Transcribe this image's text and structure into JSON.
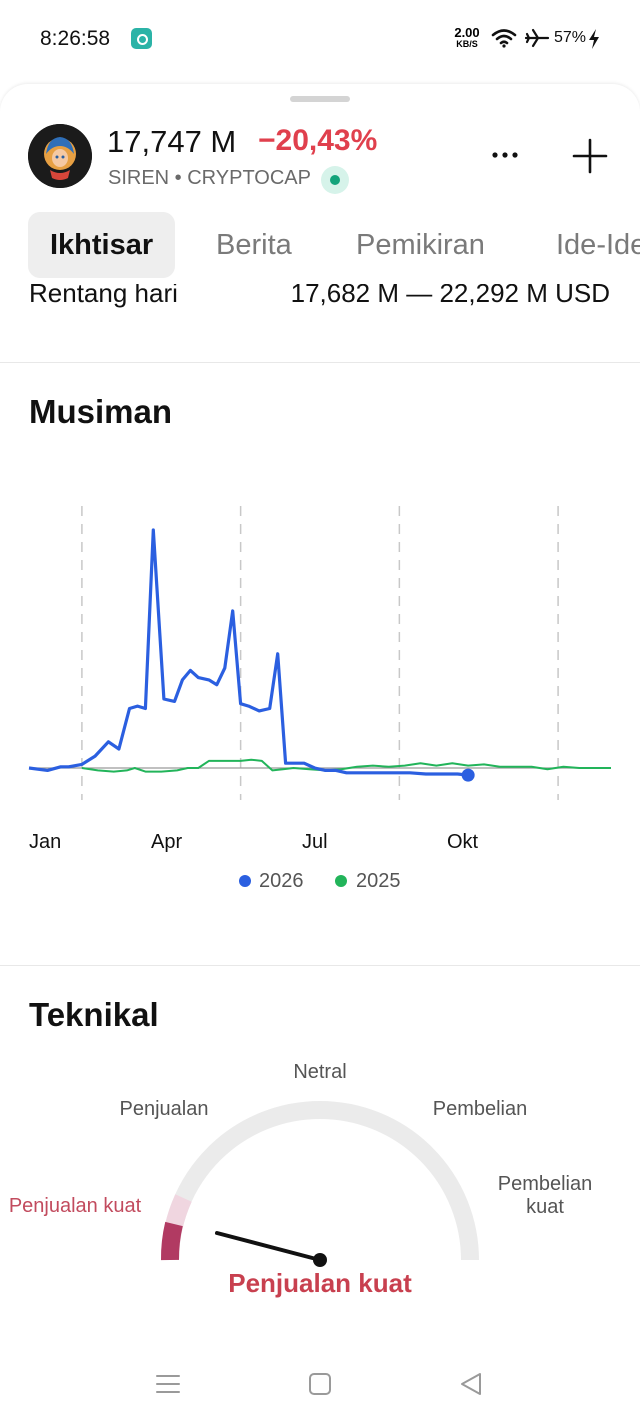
{
  "status_bar": {
    "time": "8:26:58",
    "net_speed_value": "2.00",
    "net_speed_unit": "KB/S",
    "battery": "57%",
    "icons": [
      "app-notification-icon",
      "wifi-icon",
      "airplane-mode-icon",
      "charging-bolt-icon"
    ]
  },
  "header": {
    "price": "17,747 M",
    "change": "−20,43%",
    "symbol": "SIREN • CRYPTOCAP",
    "colors": {
      "negative": "#e0404d",
      "live": "#13a37b"
    }
  },
  "tabs": [
    {
      "label": "Ikhtisar",
      "active": true
    },
    {
      "label": "Berita",
      "active": false
    },
    {
      "label": "Pemikiran",
      "active": false
    },
    {
      "label": "Ide-Ide",
      "active": false
    }
  ],
  "range_row": {
    "label": "Rentang hari",
    "value": "17,682 M — 22,292 M USD"
  },
  "seasonal": {
    "title": "Musiman",
    "x_ticks": [
      "Jan",
      "Apr",
      "Jul",
      "Okt"
    ],
    "legend": [
      {
        "label": "2026",
        "color": "#2b5fe0"
      },
      {
        "label": "2025",
        "color": "#22b45a"
      }
    ]
  },
  "chart_data": {
    "type": "line",
    "x_unit": "month",
    "xlim": [
      1,
      12
    ],
    "grid_vertical_at": [
      "Feb",
      "May",
      "Aug",
      "Nov"
    ],
    "baseline": 0,
    "series": [
      {
        "name": "2026",
        "color": "#2b5fe0",
        "x": [
          1,
          1.35,
          1.6,
          1.75,
          2.0,
          2.25,
          2.5,
          2.7,
          2.9,
          3.05,
          3.2,
          3.35,
          3.55,
          3.75,
          3.9,
          4.05,
          4.2,
          4.4,
          4.55,
          4.7,
          4.85,
          5.0,
          5.15,
          5.35,
          5.55,
          5.7,
          5.85,
          6.0,
          6.2,
          6.4,
          6.6,
          6.8,
          7.0,
          7.3,
          7.6,
          7.9,
          8.2,
          8.5,
          8.8,
          9.1,
          9.3
        ],
        "y": [
          0,
          -1,
          0.5,
          0.5,
          1.5,
          5,
          11,
          8,
          25,
          26,
          25,
          100,
          29,
          28,
          37,
          41,
          38,
          37,
          35,
          42,
          66,
          27,
          26,
          24,
          25,
          48,
          2,
          2,
          2,
          0,
          -1,
          -1,
          -2,
          -2,
          -2,
          -2,
          -2,
          -2.5,
          -2.5,
          -2.5,
          -3
        ]
      },
      {
        "name": "2025",
        "color": "#22b45a",
        "x": [
          2.0,
          2.3,
          2.6,
          2.85,
          3.0,
          3.2,
          3.5,
          3.8,
          4.0,
          4.2,
          4.4,
          4.6,
          4.8,
          5.0,
          5.2,
          5.4,
          5.6,
          5.8,
          6.0,
          6.3,
          6.6,
          6.9,
          7.2,
          7.5,
          7.8,
          8.1,
          8.4,
          8.7,
          9.0,
          9.3,
          9.6,
          9.9,
          10.2,
          10.5,
          10.8,
          11.1,
          11.4,
          11.7,
          12.0
        ],
        "y": [
          0,
          -1,
          -1.5,
          -1,
          0,
          -1.5,
          -1.5,
          -1,
          0,
          0,
          3,
          3,
          3,
          3,
          3.5,
          3,
          -1,
          -0.5,
          0,
          -0.5,
          -1,
          -0.5,
          0.5,
          1,
          0.5,
          1,
          2,
          1,
          2,
          1,
          1.5,
          0.5,
          0.5,
          0.5,
          -0.5,
          0.5,
          0,
          0,
          0
        ]
      }
    ]
  },
  "technical": {
    "title": "Teknikal",
    "labels": {
      "strong_sell": "Penjualan kuat",
      "sell": "Penjualan",
      "neutral": "Netral",
      "buy": "Pembelian",
      "strong_buy": "Pembelian kuat"
    },
    "result": "Penjualan kuat",
    "needle_level": 0.08,
    "colors": {
      "sell_strong": "#b13a62",
      "sell_strong_light": "#f0d6e0",
      "track": "#ebebeb",
      "result": "#c8404f"
    }
  },
  "nav_bar": {
    "icons": [
      "menu-icon",
      "home-square-icon",
      "back-triangle-icon"
    ]
  }
}
